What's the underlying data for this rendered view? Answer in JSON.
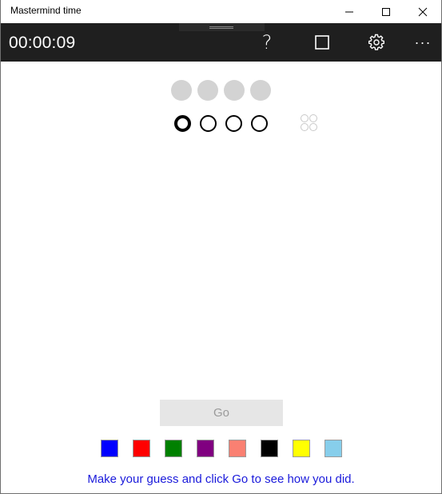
{
  "window": {
    "title": "Mastermind time"
  },
  "toolbar": {
    "timer": "00:00:09",
    "help_glyph": "?",
    "more_glyph": "···"
  },
  "board": {
    "secret_slots": 4,
    "guess_slots": 4,
    "active_guess_slot": 0,
    "feedback_pegs": 4,
    "secret_color": "#d3d3d3"
  },
  "controls": {
    "go_label": "Go"
  },
  "palette": [
    {
      "name": "blue",
      "color": "#0000ff"
    },
    {
      "name": "red",
      "color": "#ff0000"
    },
    {
      "name": "green",
      "color": "#008000"
    },
    {
      "name": "purple",
      "color": "#800080"
    },
    {
      "name": "salmon",
      "color": "#fa8072"
    },
    {
      "name": "black",
      "color": "#000000"
    },
    {
      "name": "yellow",
      "color": "#ffff00"
    },
    {
      "name": "skyblue",
      "color": "#87ceeb"
    }
  ],
  "status": {
    "message": "Make your guess and click Go to see how you did."
  }
}
